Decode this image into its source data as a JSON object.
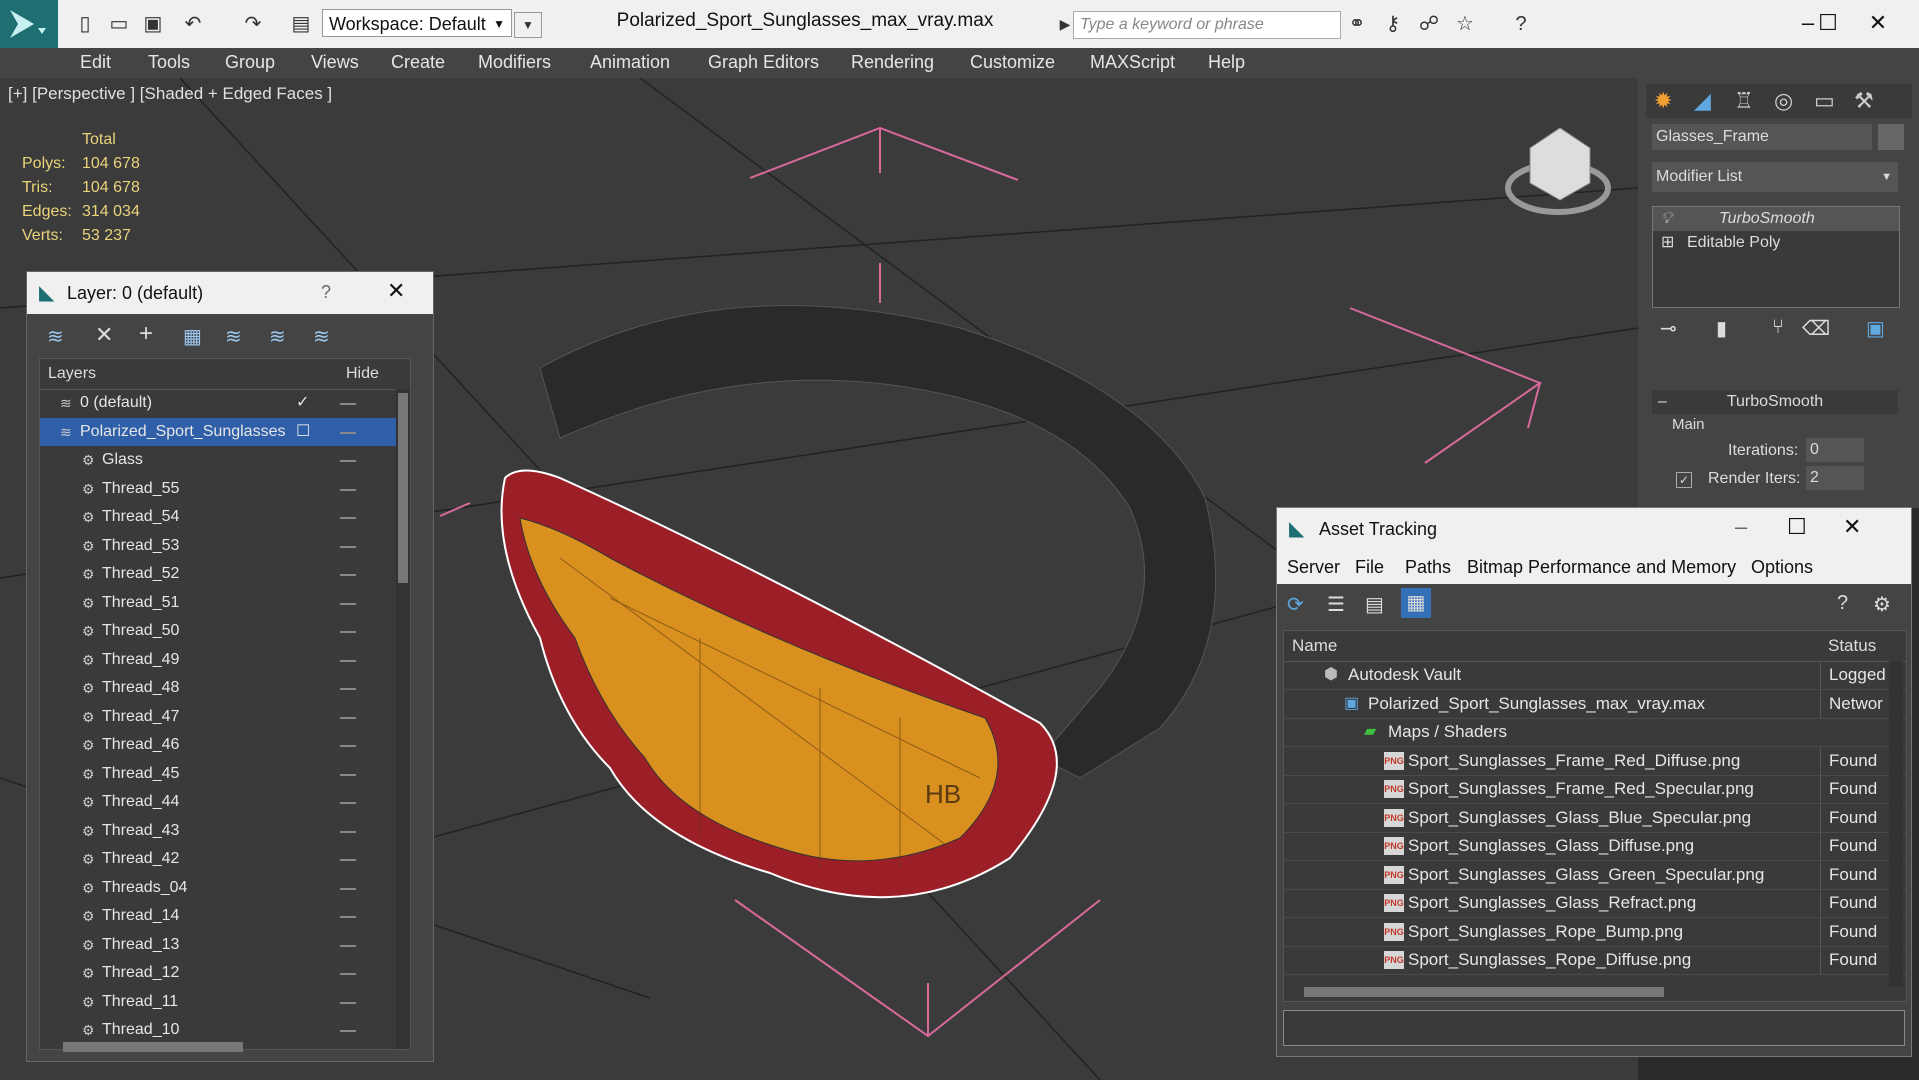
{
  "titlebar": {
    "workspace_label": "Workspace: Default",
    "file_title": "Polarized_Sport_Sunglasses_max_vray.max",
    "search_placeholder": "Type a keyword or phrase"
  },
  "menu": [
    "Edit",
    "Tools",
    "Group",
    "Views",
    "Create",
    "Modifiers",
    "Animation",
    "Graph Editors",
    "Rendering",
    "Customize",
    "MAXScript",
    "Help"
  ],
  "viewport": {
    "label": "[+] [Perspective ] [Shaded + Edged Faces ]",
    "stats": {
      "header": "Total",
      "rows": [
        {
          "label": "Polys:",
          "value": "104 678"
        },
        {
          "label": "Tris:",
          "value": "104 678"
        },
        {
          "label": "Edges:",
          "value": "314 034"
        },
        {
          "label": "Verts:",
          "value": "53 237"
        }
      ]
    },
    "logo_text": "HB"
  },
  "command_panel": {
    "object_name": "Glasses_Frame",
    "modifier_list": "Modifier List",
    "stack": [
      "TurboSmooth",
      "Editable Poly"
    ],
    "rollout_title": "TurboSmooth",
    "group_label": "Main",
    "iterations_label": "Iterations:",
    "iterations_value": "0",
    "render_iters_label": "Render Iters:",
    "render_iters_value": "2"
  },
  "layer_dialog": {
    "title": "Layer: 0 (default)",
    "help": "?",
    "col_layers": "Layers",
    "col_hide": "Hide",
    "default_layer": "0 (default)",
    "active_layer": "Polarized_Sport_Sunglasses",
    "children": [
      "Glass",
      "Thread_55",
      "Thread_54",
      "Thread_53",
      "Thread_52",
      "Thread_51",
      "Thread_50",
      "Thread_49",
      "Thread_48",
      "Thread_47",
      "Thread_46",
      "Thread_45",
      "Thread_44",
      "Thread_43",
      "Thread_42",
      "Threads_04",
      "Thread_14",
      "Thread_13",
      "Thread_12",
      "Thread_11",
      "Thread_10"
    ]
  },
  "asset_dialog": {
    "title": "Asset Tracking",
    "menu": [
      "Server",
      "File",
      "Paths",
      "Bitmap Performance and Memory",
      "Options"
    ],
    "col_name": "Name",
    "col_status": "Status",
    "rows": [
      {
        "name": "Autodesk Vault",
        "status": "Logged",
        "level": 1
      },
      {
        "name": "Polarized_Sport_Sunglasses_max_vray.max",
        "status": "Networ",
        "level": 2
      },
      {
        "name": "Maps / Shaders",
        "status": "",
        "level": 3
      },
      {
        "name": "Sport_Sunglasses_Frame_Red_Diffuse.png",
        "status": "Found",
        "level": 4
      },
      {
        "name": "Sport_Sunglasses_Frame_Red_Specular.png",
        "status": "Found",
        "level": 4
      },
      {
        "name": "Sport_Sunglasses_Glass_Blue_Specular.png",
        "status": "Found",
        "level": 4
      },
      {
        "name": "Sport_Sunglasses_Glass_Diffuse.png",
        "status": "Found",
        "level": 4
      },
      {
        "name": "Sport_Sunglasses_Glass_Green_Specular.png",
        "status": "Found",
        "level": 4
      },
      {
        "name": "Sport_Sunglasses_Glass_Refract.png",
        "status": "Found",
        "level": 4
      },
      {
        "name": "Sport_Sunglasses_Rope_Bump.png",
        "status": "Found",
        "level": 4
      },
      {
        "name": "Sport_Sunglasses_Rope_Diffuse.png",
        "status": "Found",
        "level": 4
      }
    ]
  },
  "colors": {
    "selection": "#2f5fa8",
    "stats_yellow": "#e8d37a",
    "gizmo_pink": "#d86a9b",
    "lens_orange": "#d9901f",
    "frame_red": "#9c1f28"
  }
}
